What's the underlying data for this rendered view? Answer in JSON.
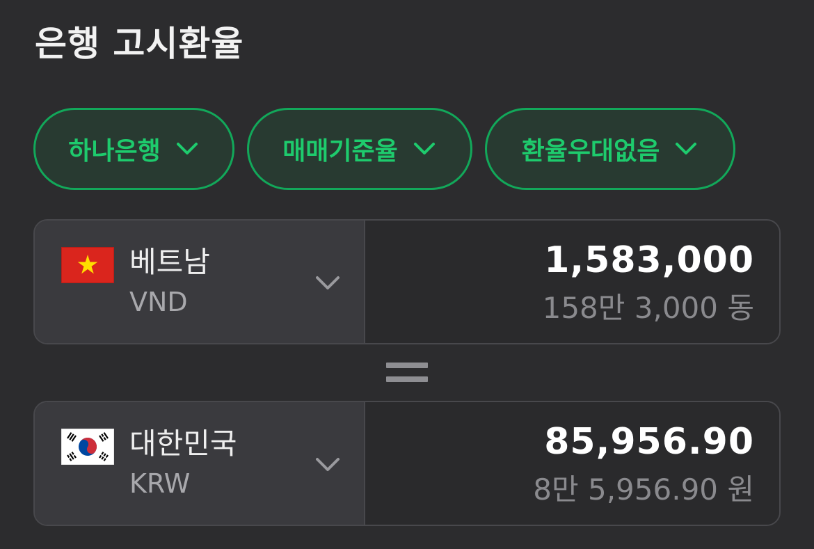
{
  "page": {
    "title": "은행 고시환율"
  },
  "filters": [
    {
      "label": "하나은행",
      "icon": "chevron-down-icon"
    },
    {
      "label": "매매기준율",
      "icon": "chevron-down-icon"
    },
    {
      "label": "환율우대없음",
      "icon": "chevron-down-icon"
    }
  ],
  "from_currency": {
    "flag_icon": "vietnam-flag-icon",
    "country": "베트남",
    "code": "VND",
    "amount": "1,583,000",
    "amount_words": "158만 3,000 동"
  },
  "to_currency": {
    "flag_icon": "south-korea-flag-icon",
    "country": "대한민국",
    "code": "KRW",
    "amount": "85,956.90",
    "amount_words": "8만 5,956.90 원"
  },
  "colors": {
    "background": "#2c2c2e",
    "accent_green": "#1ecb6d",
    "chip_border": "#12a85a",
    "chip_background": "#283a31",
    "card_left": "#3a3a3e",
    "card_right": "#2a2a2c"
  }
}
